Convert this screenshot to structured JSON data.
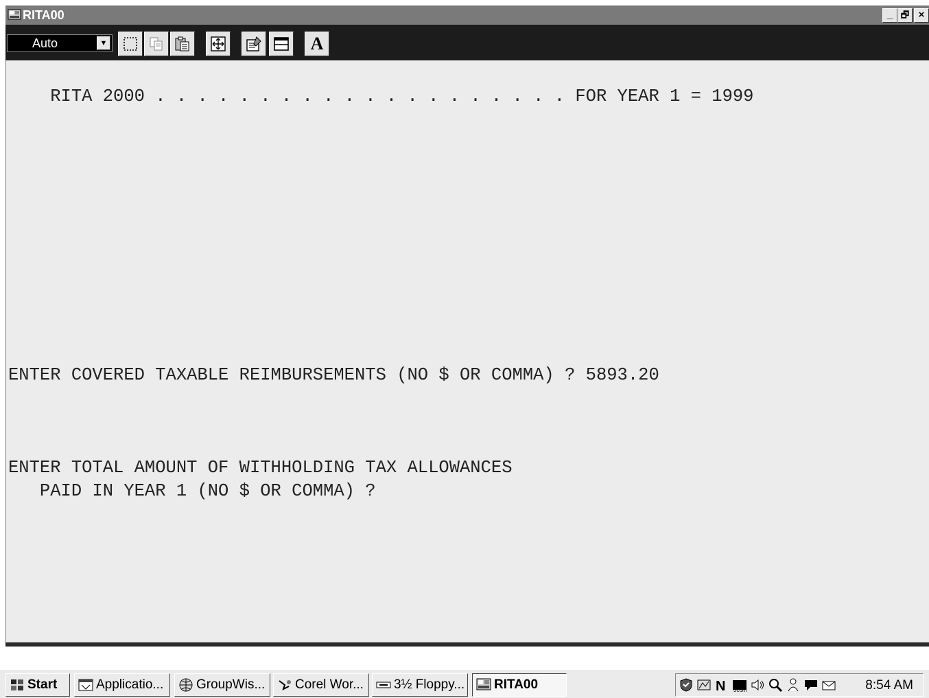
{
  "window": {
    "title": "RITA00",
    "minimize_label": "_",
    "maximize_label": "🗗",
    "close_label": "×"
  },
  "toolbar": {
    "font_size_value": "Auto",
    "buttons": [
      {
        "name": "mark-icon"
      },
      {
        "name": "copy-icon"
      },
      {
        "name": "paste-icon"
      },
      {
        "name": "fullscreen-icon"
      },
      {
        "name": "properties-icon"
      },
      {
        "name": "background-icon"
      },
      {
        "name": "font-icon",
        "label": "A"
      }
    ]
  },
  "console": {
    "header": "RITA 2000 . . . . . . . . . . . . . . . . . . . . FOR YEAR 1 = 1999",
    "prompt1": "ENTER COVERED TAXABLE REIMBURSEMENTS (NO $ OR COMMA) ? 5893.20",
    "prompt2_line1": "ENTER TOTAL AMOUNT OF WITHHOLDING TAX ALLOWANCES",
    "prompt2_line2": "   PAID IN YEAR 1 (NO $ OR COMMA) ?"
  },
  "taskbar": {
    "start_label": "Start",
    "tasks": [
      {
        "label": "Applicatio..."
      },
      {
        "label": "GroupWis..."
      },
      {
        "label": "Corel Wor..."
      },
      {
        "label": "3½ Floppy..."
      },
      {
        "label": "RITA00",
        "active": true
      }
    ],
    "tray_icons": [
      "shield-icon",
      "network-icon",
      "norton-icon",
      "3com-icon",
      "volume-icon",
      "search-icon",
      "user-icon",
      "chat-icon",
      "mail-icon"
    ],
    "clock": "8:54 AM"
  },
  "colors": {
    "titlebar": "#7a7a7a",
    "toolbar": "#1c1c1c",
    "console_bg": "#ececec",
    "taskbar": "#ebebeb"
  }
}
